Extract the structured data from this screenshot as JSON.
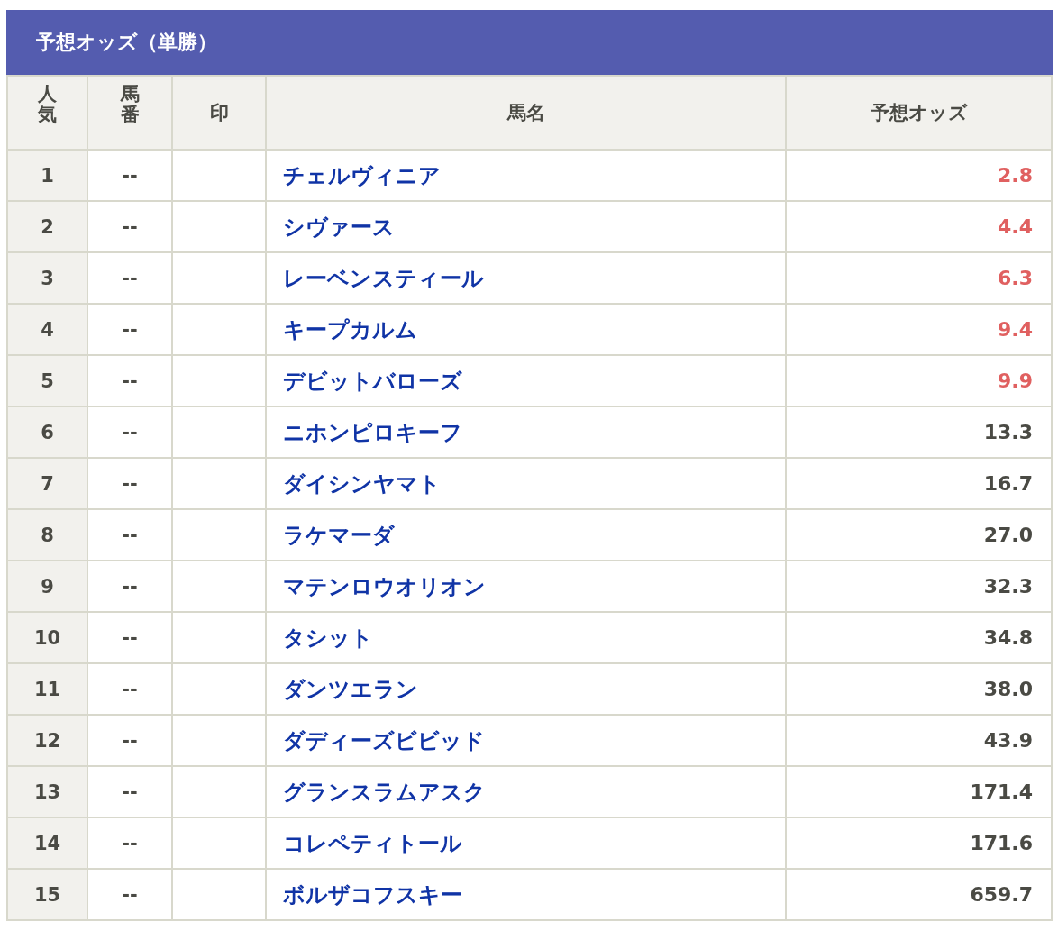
{
  "title": "予想オッズ（単勝）",
  "table": {
    "columns": [
      "人気",
      "馬番",
      "印",
      "馬名",
      "予想オッズ"
    ],
    "rows": [
      {
        "rank": "1",
        "number": "--",
        "horse": "チェルヴィニア",
        "odds": "2.8",
        "highlighted": true
      },
      {
        "rank": "2",
        "number": "--",
        "horse": "シヴァース",
        "odds": "4.4",
        "highlighted": true
      },
      {
        "rank": "3",
        "number": "--",
        "horse": "レーベンスティール",
        "odds": "6.3",
        "highlighted": true
      },
      {
        "rank": "4",
        "number": "--",
        "horse": "キープカルム",
        "odds": "9.4",
        "highlighted": true
      },
      {
        "rank": "5",
        "number": "--",
        "horse": "デビットバローズ",
        "odds": "9.9",
        "highlighted": true
      },
      {
        "rank": "6",
        "number": "--",
        "horse": "ニホンピロキーフ",
        "odds": "13.3",
        "highlighted": false
      },
      {
        "rank": "7",
        "number": "--",
        "horse": "ダイシンヤマト",
        "odds": "16.7",
        "highlighted": false
      },
      {
        "rank": "8",
        "number": "--",
        "horse": "ラケマーダ",
        "odds": "27.0",
        "highlighted": false
      },
      {
        "rank": "9",
        "number": "--",
        "horse": "マテンロウオリオン",
        "odds": "32.3",
        "highlighted": false
      },
      {
        "rank": "10",
        "number": "--",
        "horse": "タシット",
        "odds": "34.8",
        "highlighted": false
      },
      {
        "rank": "11",
        "number": "--",
        "horse": "ダンツエラン",
        "odds": "38.0",
        "highlighted": false
      },
      {
        "rank": "12",
        "number": "--",
        "horse": "ダディーズビビッド",
        "odds": "43.9",
        "highlighted": false
      },
      {
        "rank": "13",
        "number": "--",
        "horse": "グランスラムアスク",
        "odds": "171.4",
        "highlighted": false
      },
      {
        "rank": "14",
        "number": "--",
        "horse": "コレペティトール",
        "odds": "171.6",
        "highlighted": false
      },
      {
        "rank": "15",
        "number": "--",
        "horse": "ボルザコフスキー",
        "odds": "659.7",
        "highlighted": false
      }
    ]
  }
}
